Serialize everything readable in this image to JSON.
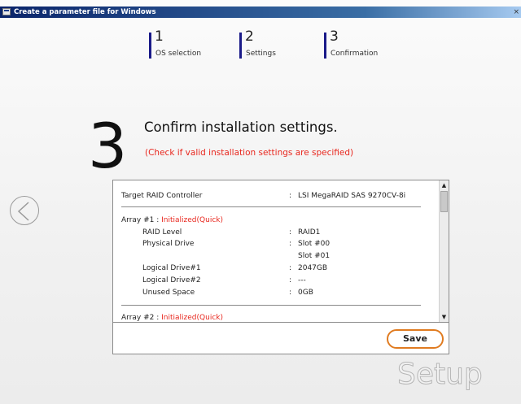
{
  "window": {
    "title": "Create a parameter file for Windows",
    "close_glyph": "×"
  },
  "steps": [
    {
      "number": "1",
      "label": "OS selection"
    },
    {
      "number": "2",
      "label": "Settings"
    },
    {
      "number": "3",
      "label": "Confirmation"
    }
  ],
  "current_step": "3",
  "heading": "Confirm installation settings.",
  "subheading": "(Check if valid installation settings are specified)",
  "summary": {
    "controller_label": "Target RAID Controller",
    "controller_value": "LSI MegaRAID SAS 9270CV-8i",
    "array1_title": "Array #1 :",
    "array1_status": "Initialized(Quick)",
    "raid_level_label": "RAID Level",
    "raid_level_value": "RAID1",
    "physical_drive_label": "Physical Drive",
    "physical_drive_values": [
      "Slot #00",
      "Slot #01"
    ],
    "logical_drive1_label": "Logical Drive#1",
    "logical_drive1_value": "2047GB",
    "logical_drive2_label": "Logical Drive#2",
    "logical_drive2_value": "---",
    "unused_space_label": "Unused Space",
    "unused_space_value": "0GB",
    "array2_title": "Array #2 :",
    "array2_status": "Initialized(Quick)",
    "colon": ":"
  },
  "buttons": {
    "save_label": "Save"
  },
  "logo_text": "Setup",
  "icons": {
    "back": "chevron-left-circle-icon",
    "scroll_up": "arrow-up-icon",
    "scroll_down": "arrow-down-icon"
  },
  "colors": {
    "title_bar": "#0a246a",
    "accent_red": "#e8271e",
    "step_bar": "#1a1a88",
    "save_border": "#e07b20"
  }
}
